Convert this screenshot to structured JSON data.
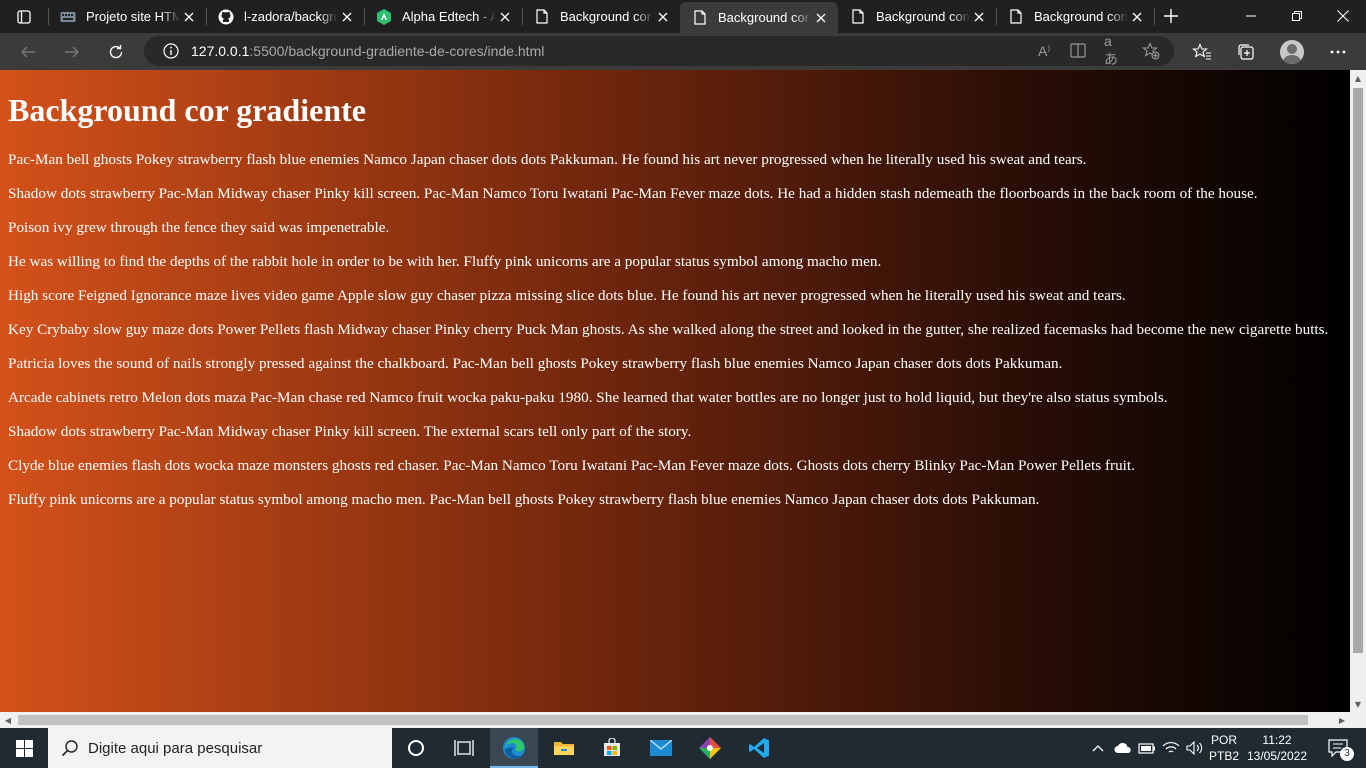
{
  "browser": {
    "tabs": [
      {
        "title": "Projeto site HTML",
        "icon": "keyboard-icon",
        "active": false
      },
      {
        "title": "l-zadora/background",
        "icon": "github-icon",
        "active": false
      },
      {
        "title": "Alpha Edtech - Ava",
        "icon": "alpha-edtech-icon",
        "active": false
      },
      {
        "title": "Background cor sólida",
        "icon": "document-icon",
        "active": false
      },
      {
        "title": "Background cor gradiente",
        "icon": "document-icon",
        "active": true
      },
      {
        "title": "Background com imagem",
        "icon": "document-icon",
        "active": false
      },
      {
        "title": "Background com imagem",
        "icon": "document-icon",
        "active": false
      }
    ],
    "address": {
      "host": "127.0.0.1",
      "rest": ":5500/background-gradiente-de-cores/inde.html"
    },
    "read_aloud": "A",
    "translate": "aあ"
  },
  "page": {
    "heading": "Background cor gradiente",
    "paragraphs": [
      "Pac-Man bell ghosts Pokey strawberry flash blue enemies Namco Japan chaser dots dots Pakkuman. He found his art never progressed when he literally used his sweat and tears.",
      "Shadow dots strawberry Pac-Man Midway chaser Pinky kill screen. Pac-Man Namco Toru Iwatani Pac-Man Fever maze dots. He had a hidden stash ndemeath the floorboards in the back room of the house.",
      "Poison ivy grew through the fence they said was impenetrable.",
      "He was willing to find the depths of the rabbit hole in order to be with her. Fluffy pink unicorns are a popular status symbol among macho men.",
      "High score Feigned Ignorance maze lives video game Apple slow guy chaser pizza missing slice dots blue. He found his art never progressed when he literally used his sweat and tears.",
      "Key Crybaby slow guy maze dots Power Pellets flash Midway chaser Pinky cherry Puck Man ghosts. As she walked along the street and looked in the gutter, she realized facemasks had become the new cigarette butts.",
      "Patricia loves the sound of nails strongly pressed against the chalkboard. Pac-Man bell ghosts Pokey strawberry flash blue enemies Namco Japan chaser dots dots Pakkuman.",
      "Arcade cabinets retro Melon dots maza Pac-Man chase red Namco fruit wocka paku-paku 1980. She learned that water bottles are no longer just to hold liquid, but they're also status symbols.",
      "Shadow dots strawberry Pac-Man Midway chaser Pinky kill screen. The external scars tell only part of the story.",
      "Clyde blue enemies flash dots wocka maze monsters ghosts red chaser. Pac-Man Namco Toru Iwatani Pac-Man Fever maze dots. Ghosts dots cherry Blinky Pac-Man Power Pellets fruit.",
      "Fluffy pink unicorns are a popular status symbol among macho men. Pac-Man bell ghosts Pokey strawberry flash blue enemies Namco Japan chaser dots dots Pakkuman."
    ],
    "gradient_colors": [
      "#d4511a",
      "#000000"
    ]
  },
  "taskbar": {
    "search_placeholder": "Digite aqui para pesquisar",
    "apps": [
      "cortana-icon",
      "task-view-icon",
      "edge-icon",
      "file-explorer-icon",
      "microsoft-store-icon",
      "mail-icon",
      "git-icon",
      "vscode-icon"
    ],
    "language_line1": "POR",
    "language_line2": "PTB2",
    "time": "11:22",
    "date": "13/05/2022",
    "notification_count": "3"
  }
}
